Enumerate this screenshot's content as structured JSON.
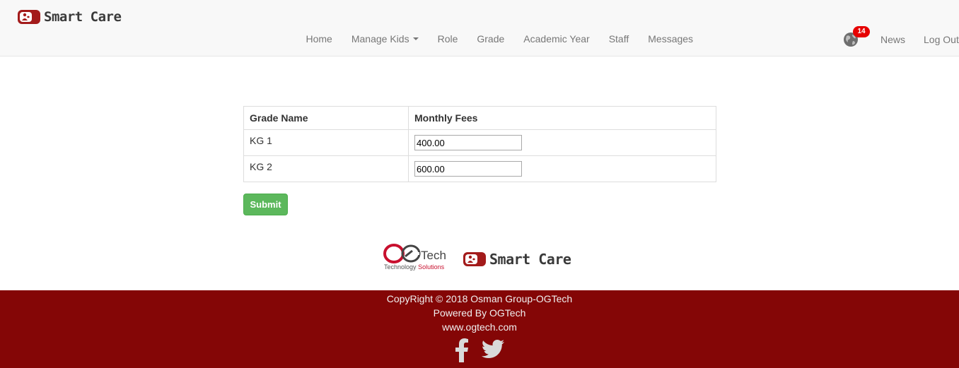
{
  "header": {
    "brand": "Smart Care",
    "nav": [
      {
        "label": "Home"
      },
      {
        "label": "Manage Kids",
        "dropdown": true
      },
      {
        "label": "Role"
      },
      {
        "label": "Grade"
      },
      {
        "label": "Academic Year"
      },
      {
        "label": "Staff"
      },
      {
        "label": "Messages"
      }
    ],
    "notifications": {
      "icon": "globe-icon",
      "count": "14"
    },
    "news_label": "News",
    "logout_label": "Log Out"
  },
  "table": {
    "headers": [
      "Grade Name",
      "Monthly Fees"
    ],
    "rows": [
      {
        "grade": "KG 1",
        "fee": "400.00"
      },
      {
        "grade": "KG 2",
        "fee": "600.00"
      }
    ]
  },
  "submit_label": "Submit",
  "logos": {
    "ogtech_main": "Tech",
    "ogtech_sub_1": "Technology",
    "ogtech_sub_2": "Solutions",
    "smartcare": "Smart Care"
  },
  "footer": {
    "copyright": "CopyRight © 2018 Osman Group-OGTech",
    "powered": "Powered By OGTech",
    "website": "www.ogtech.com",
    "social": [
      "facebook-icon",
      "twitter-icon"
    ]
  },
  "colors": {
    "footer_bg": "#840606",
    "submit_bg": "#5cb85c",
    "badge": "#e60000",
    "brand_red": "#a31b1b"
  }
}
